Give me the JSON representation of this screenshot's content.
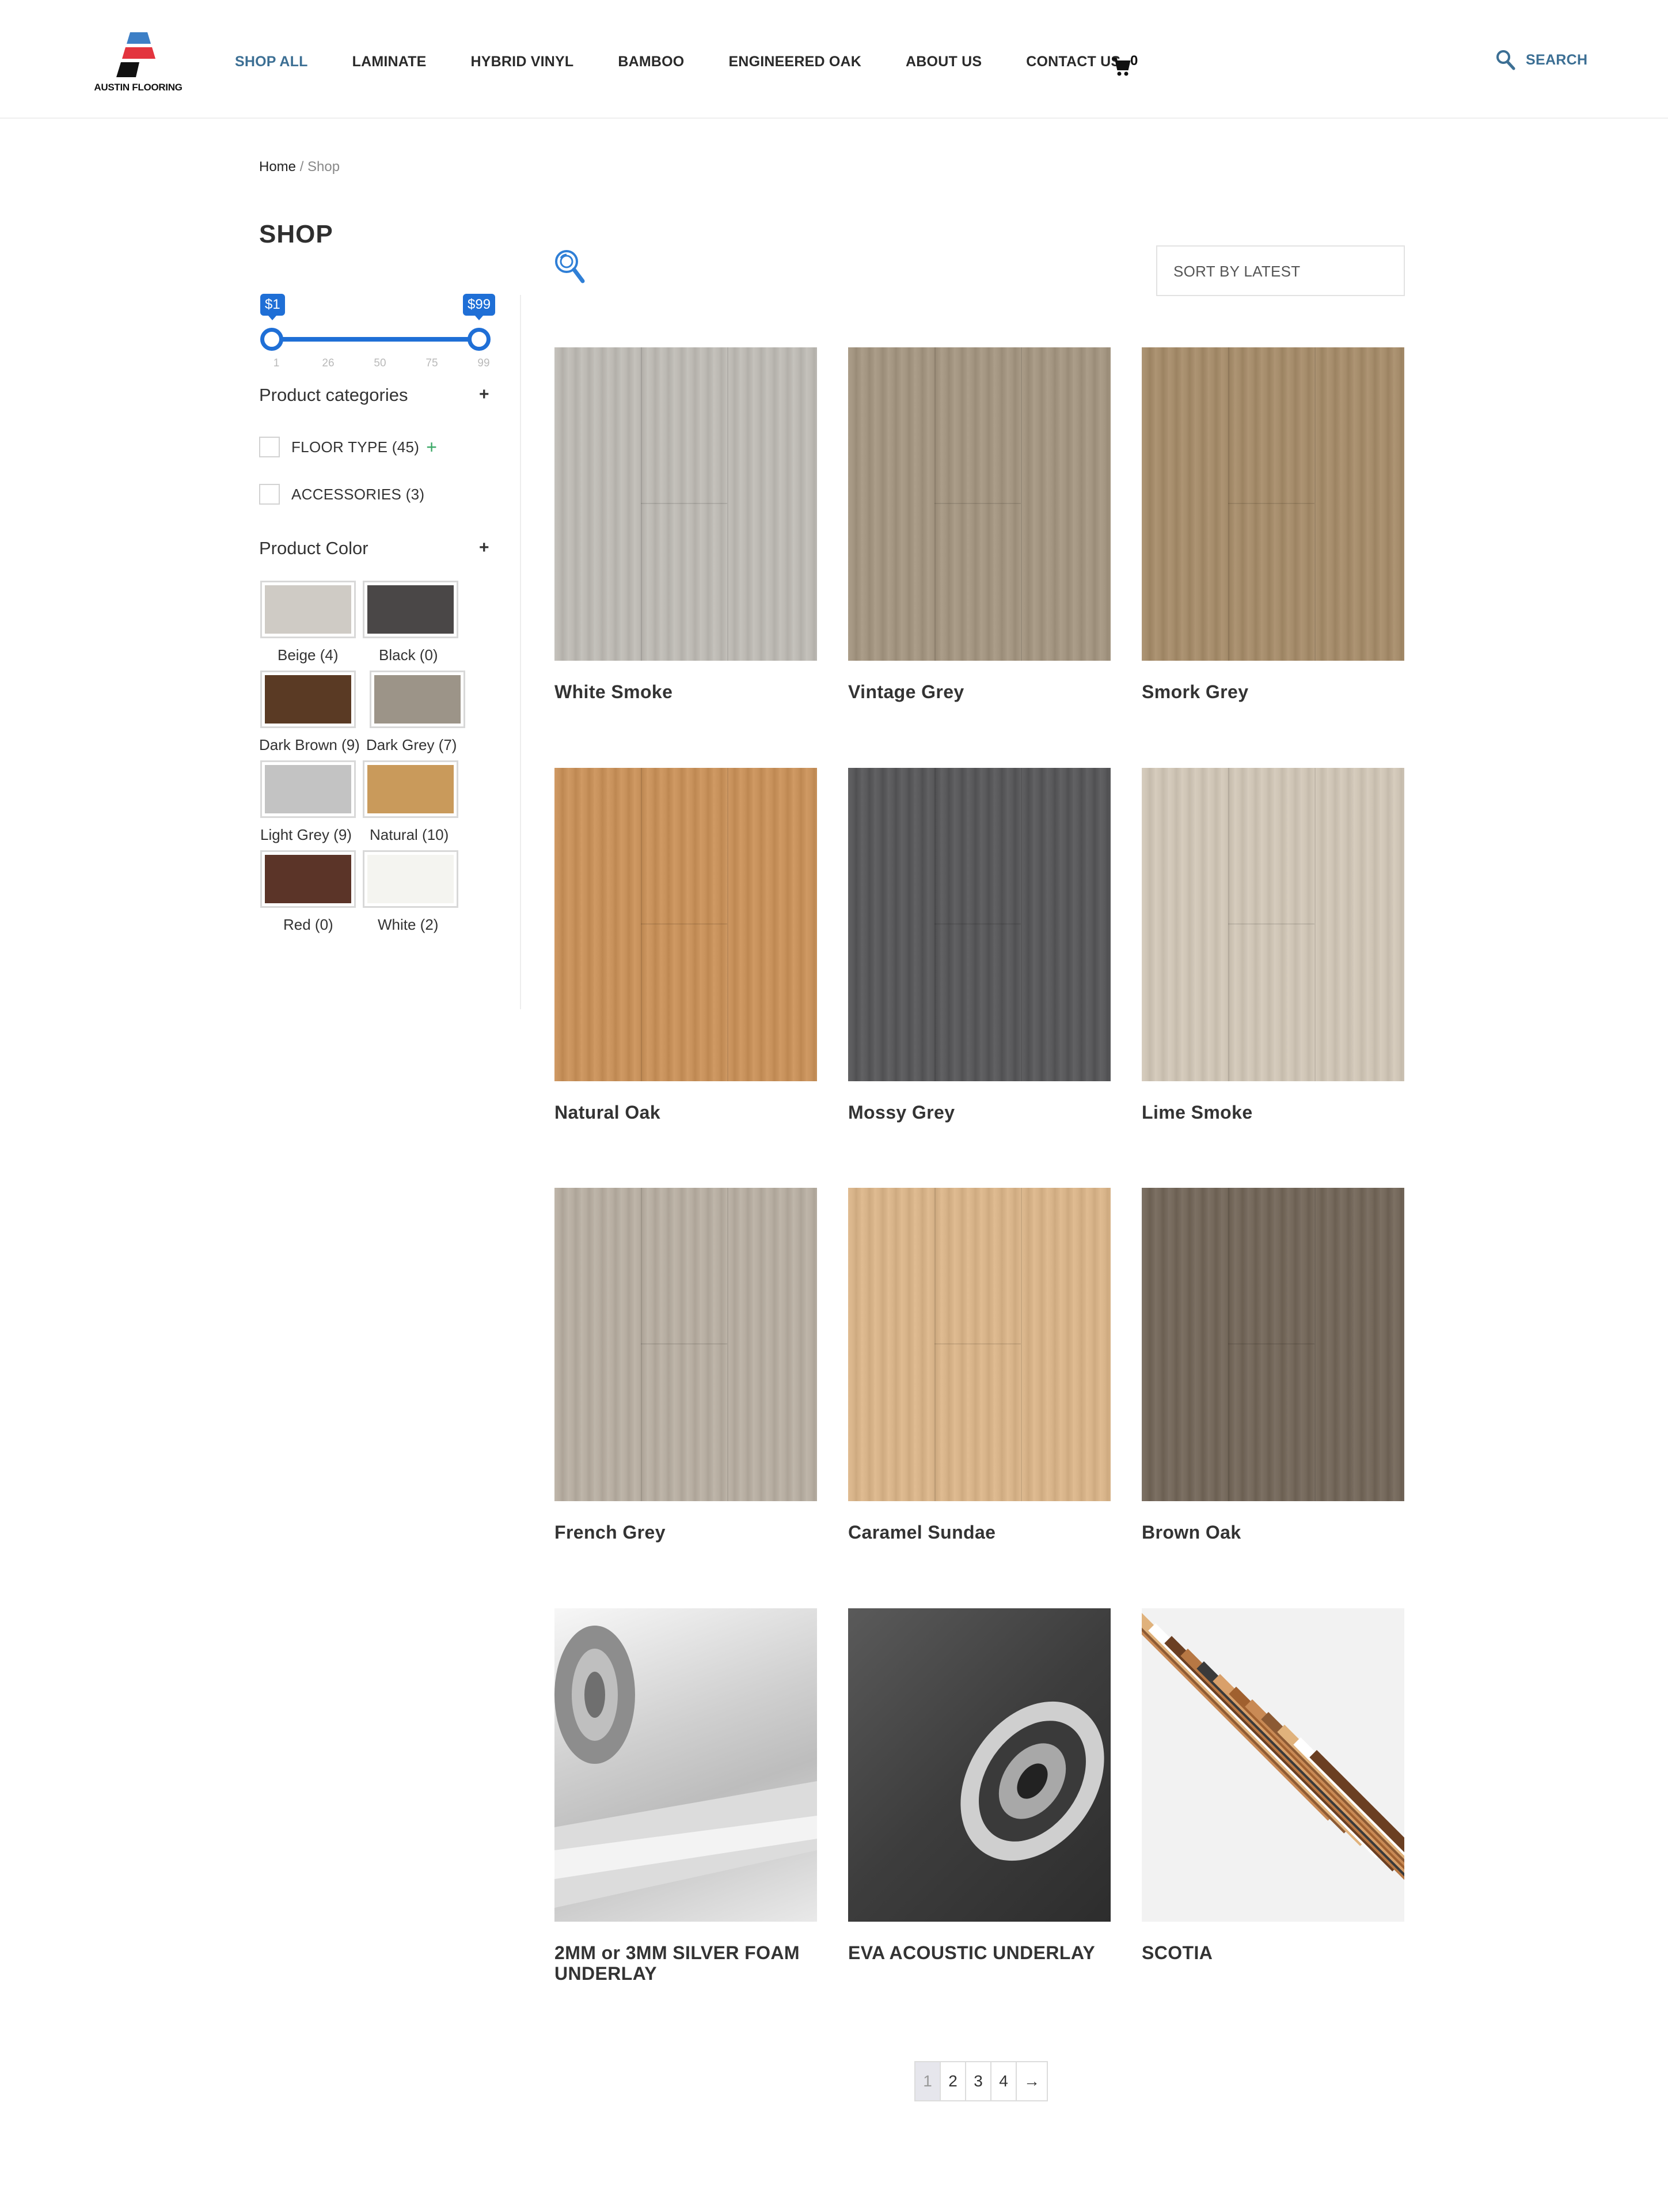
{
  "brand": {
    "name": "AUSTIN FLOORING"
  },
  "nav": {
    "items": [
      {
        "label": "SHOP ALL",
        "active": true
      },
      {
        "label": "LAMINATE",
        "active": false
      },
      {
        "label": "HYBRID VINYL",
        "active": false
      },
      {
        "label": "BAMBOO",
        "active": false
      },
      {
        "label": "ENGINEERED OAK",
        "active": false
      },
      {
        "label": "ABOUT US",
        "active": false
      },
      {
        "label": "CONTACT US",
        "active": false
      }
    ],
    "cart_count": "0",
    "search_label": "SEARCH",
    "accent_color": "#3c6f94"
  },
  "breadcrumb": {
    "home": "Home",
    "separator": " / ",
    "current": "Shop"
  },
  "sidebar": {
    "title": "SHOP",
    "price_filter": {
      "min_label": "$1",
      "max_label": "$99",
      "min_value": 1,
      "max_value": 99,
      "ticks": [
        "1",
        "26",
        "50",
        "75",
        "99"
      ],
      "color": "#1f6fd6"
    },
    "categories": {
      "title": "Product categories",
      "toggle": "+",
      "items": [
        {
          "label": "FLOOR TYPE (45)",
          "expand": "+"
        },
        {
          "label": "ACCESSORIES (3)",
          "expand": ""
        }
      ]
    },
    "colors": {
      "title": "Product Color",
      "toggle": "+",
      "items": [
        {
          "label": "Beige (4)",
          "swatch": "#cfcbc5"
        },
        {
          "label": "Black (0)",
          "swatch": "#4a4747"
        },
        {
          "label": "Dark Brown (9)",
          "swatch": "#5a3a24"
        },
        {
          "label": "Dark Grey (7)",
          "swatch": "#9c9488"
        },
        {
          "label": "Light Grey (9)",
          "swatch": "#c3c3c3"
        },
        {
          "label": "Natural (10)",
          "swatch": "#c99a5b"
        },
        {
          "label": "Red (0)",
          "swatch": "#5b3428"
        },
        {
          "label": "White (2)",
          "swatch": "#f4f4f0"
        }
      ]
    }
  },
  "sort": {
    "label": "SORT BY LATEST"
  },
  "products": [
    {
      "name": "White Smoke",
      "color": "#bdbab4",
      "variant": "wood"
    },
    {
      "name": "Vintage Grey",
      "color": "#a49682",
      "variant": "wood"
    },
    {
      "name": "Smork Grey",
      "color": "#a68d6c",
      "variant": "wood"
    },
    {
      "name": "Natural Oak",
      "color": "#c8925c",
      "variant": "wood"
    },
    {
      "name": "Mossy Grey",
      "color": "#5a5a5c",
      "variant": "wood"
    },
    {
      "name": "Lime Smoke",
      "color": "#cfc5b6",
      "variant": "wood"
    },
    {
      "name": "French Grey",
      "color": "#b7aea2",
      "variant": "wood"
    },
    {
      "name": "Caramel Sundae",
      "color": "#d8b48a",
      "variant": "wood"
    },
    {
      "name": "Brown Oak",
      "color": "#75695c",
      "variant": "wood"
    },
    {
      "name": "2MM or 3MM SILVER FOAM UNDERLAY",
      "color": "#d9d9d9",
      "variant": "foam"
    },
    {
      "name": "EVA ACOUSTIC UNDERLAY",
      "color": "#4a4a4a",
      "variant": "eva"
    },
    {
      "name": "SCOTIA",
      "color": "#f2f2f2",
      "variant": "scotia"
    }
  ],
  "pagination": {
    "pages": [
      "1",
      "2",
      "3",
      "4"
    ],
    "next": "→",
    "current": "1"
  }
}
